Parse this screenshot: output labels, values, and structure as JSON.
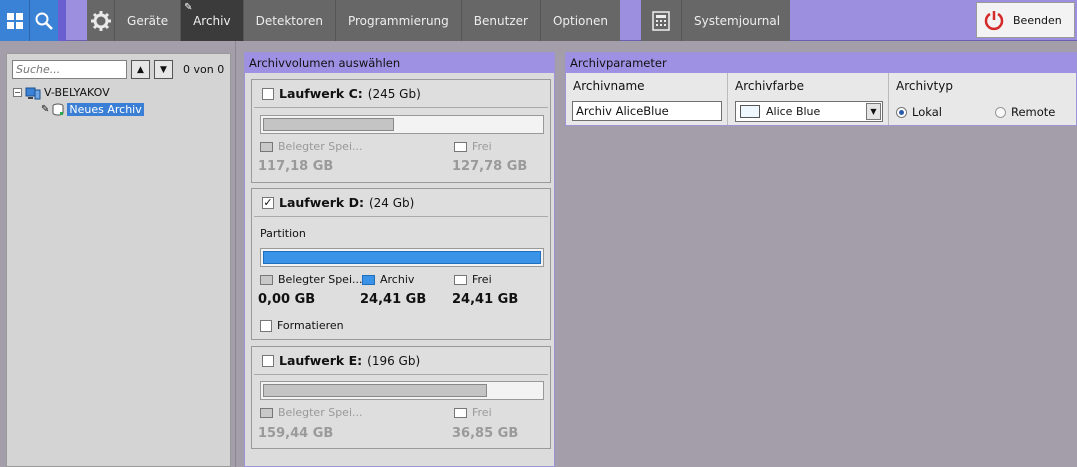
{
  "topbar": {
    "menu": [
      "Geräte",
      "Archiv",
      "Detektoren",
      "Programmierung",
      "Benutzer",
      "Optionen"
    ],
    "active": "Archiv",
    "journal": "Systemjournal",
    "quit": "Beenden"
  },
  "tree": {
    "search_placeholder": "Suche...",
    "count": "0 von 0",
    "server": "V-BELYAKOV",
    "archive": "Neues Archiv"
  },
  "volumes": {
    "title": "Archivvolumen auswählen",
    "used_label_short": "Belegter Spei...",
    "free_label": "Frei",
    "archive_label": "Archiv",
    "partition_label": "Partition",
    "format_label": "Formatieren",
    "drives": [
      {
        "name": "Laufwerk C:",
        "size": "(245 Gb)",
        "checked": false,
        "used": "117,18 GB",
        "free": "127,78 GB",
        "used_fraction": 0.48
      },
      {
        "name": "Laufwerk D:",
        "size": "(24 Gb)",
        "checked": true,
        "used": "0,00 GB",
        "archive": "24,41 GB",
        "free": "24,41 GB",
        "archive_fraction": 1.0
      },
      {
        "name": "Laufwerk E:",
        "size": "(196 Gb)",
        "checked": false,
        "used": "159,44 GB",
        "free": "36,85 GB",
        "used_fraction": 0.81
      }
    ]
  },
  "params": {
    "title": "Archivparameter",
    "name_label": "Archivname",
    "name_value": "Archiv AliceBlue",
    "color_label": "Archivfarbe",
    "color_value": "Alice Blue",
    "color_hex": "#f0f8ff",
    "type_label": "Archivtyp",
    "type_local": "Lokal",
    "type_remote": "Remote",
    "type_selected": "Lokal"
  },
  "colors": {
    "topbar": "#9d8fe0",
    "menu_bg": "#676767",
    "logo_blue": "#3a82d6",
    "archive_blue": "#3a93e6"
  }
}
